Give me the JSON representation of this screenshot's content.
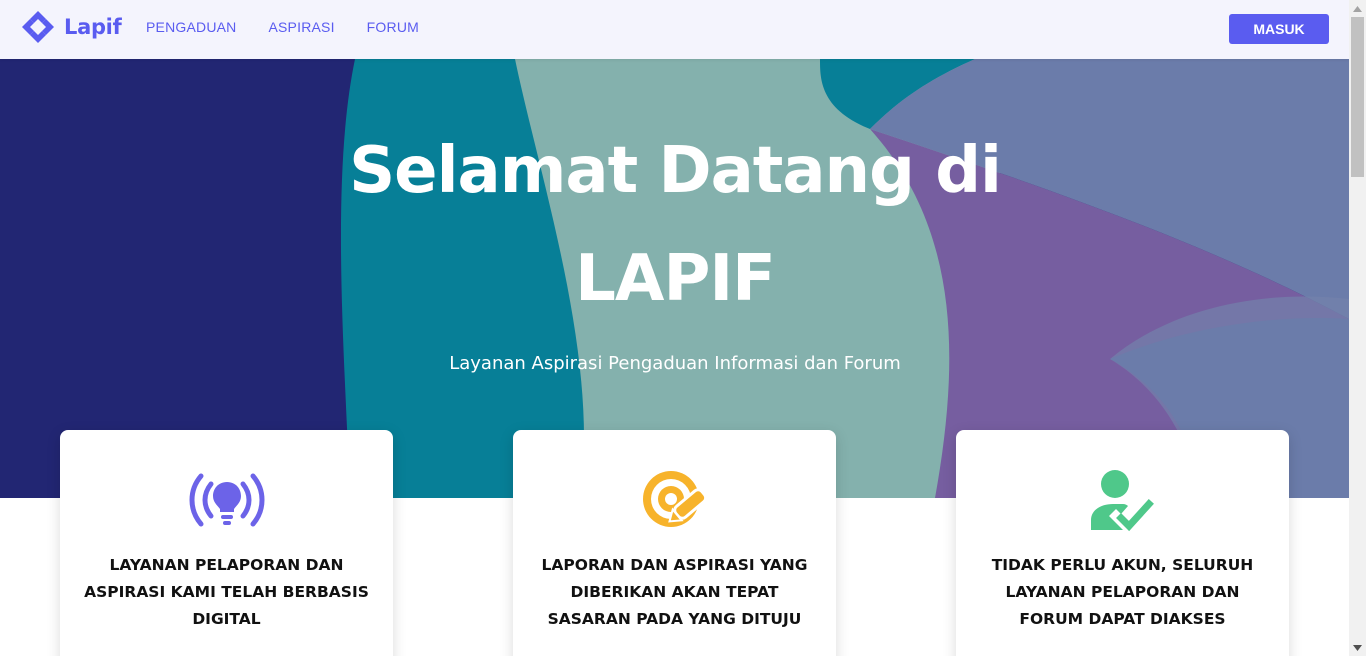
{
  "navbar": {
    "brand": "Lapif",
    "brand_icon": "lapif-logo-icon",
    "links": [
      "PENGADUAN",
      "ASPIRASI",
      "FORUM"
    ],
    "login_label": "MASUK"
  },
  "hero": {
    "title_line1": "Selamat Datang di",
    "title_line2": "LAPIF",
    "subtitle": "Layanan Aspirasi Pengaduan Informasi dan Forum"
  },
  "features": [
    {
      "icon": "broadcast-lightbulb-icon",
      "text": "LAYANAN PELAPORAN DAN ASPIRASI KAMI TELAH BERBASIS DIGITAL"
    },
    {
      "icon": "target-pencil-icon",
      "text": "LAPORAN DAN ASPIRASI YANG DIBERIKAN AKAN TEPAT SASARAN PADA YANG DITUJU"
    },
    {
      "icon": "user-check-icon",
      "text": "TIDAK PERLU AKUN, SELURUH LAYANAN PELAPORAN DAN FORUM DAPAT DIAKSES"
    }
  ],
  "colors": {
    "accent": "#5a5cf0",
    "hero_dark": "#222673",
    "hero_teal": "#077f97",
    "hero_sage": "#84b1ad",
    "hero_purple": "#765ea0",
    "hero_slate": "#6b7caa",
    "icon_purple": "#6c63e8",
    "icon_orange": "#f7b32b",
    "icon_green": "#4fc88a"
  }
}
